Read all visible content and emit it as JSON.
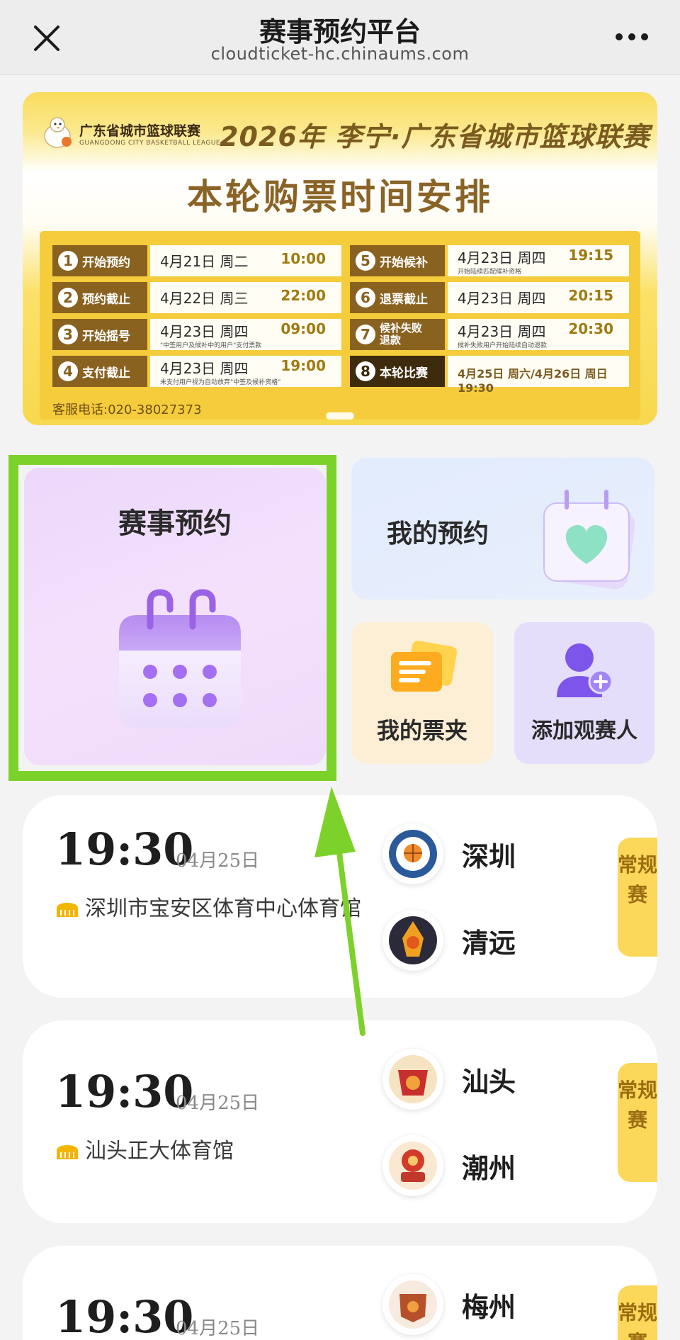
{
  "topbar": {
    "title": "赛事预约平台",
    "url": "cloudticket-hc.chinaums.com",
    "close_icon": "close-icon",
    "more_icon": "more-icon"
  },
  "banner": {
    "league_cn": "广东省城市篮球联赛",
    "league_en": "GUANGDONG CITY BASKETBALL LEAGUE",
    "headline": "2026年 李宁·广东省城市篮球联赛",
    "subtitle": "本轮购票时间安排",
    "schedule": [
      {
        "num": "1",
        "label": "开始预约",
        "date": "4月21日 周二",
        "time": "10:00",
        "note": ""
      },
      {
        "num": "2",
        "label": "预约截止",
        "date": "4月22日 周三",
        "time": "22:00",
        "note": ""
      },
      {
        "num": "3",
        "label": "开始摇号",
        "date": "4月23日 周四",
        "time": "09:00",
        "note": "\"中签用户及候补中的用户\"支付票款"
      },
      {
        "num": "4",
        "label": "支付截止",
        "date": "4月23日 周四",
        "time": "19:00",
        "note": "未支付用户视为自动放弃\"中签及候补资格\""
      },
      {
        "num": "5",
        "label": "开始候补",
        "date": "4月23日 周四",
        "time": "19:15",
        "note": "开始陆续匹配候补资格"
      },
      {
        "num": "6",
        "label": "退票截止",
        "date": "4月23日 周四",
        "time": "20:15",
        "note": ""
      },
      {
        "num": "7",
        "label": "候补失败退款",
        "date": "4月23日 周四",
        "time": "20:30",
        "note": "候补失败用户开始陆续自动退款"
      },
      {
        "num": "8",
        "label": "本轮比赛",
        "date": "4月25日 周六/4月26日 周日 19:30",
        "time": "",
        "note": ""
      }
    ],
    "phone": "客服电话:020-38027373"
  },
  "tiles": {
    "booking": "赛事预约",
    "my_booking": "我的预约",
    "wallet": "我的票夹",
    "add_viewer": "添加观赛人"
  },
  "matches": [
    {
      "time": "19:30",
      "date": "04月25日",
      "venue": "深圳市宝安区体育中心体育馆",
      "home": "深圳",
      "away": "清远",
      "tag": "常规赛"
    },
    {
      "time": "19:30",
      "date": "04月25日",
      "venue": "汕头正大体育馆",
      "home": "汕头",
      "away": "潮州",
      "tag": "常规赛"
    },
    {
      "time": "19:30",
      "date": "04月25日",
      "venue": "",
      "home": "梅州",
      "away": "",
      "tag": "常规赛"
    }
  ],
  "colors": {
    "highlight": "#7dd12b",
    "banner_gold": "#f5cc3c",
    "tag": "#fcd85a"
  }
}
